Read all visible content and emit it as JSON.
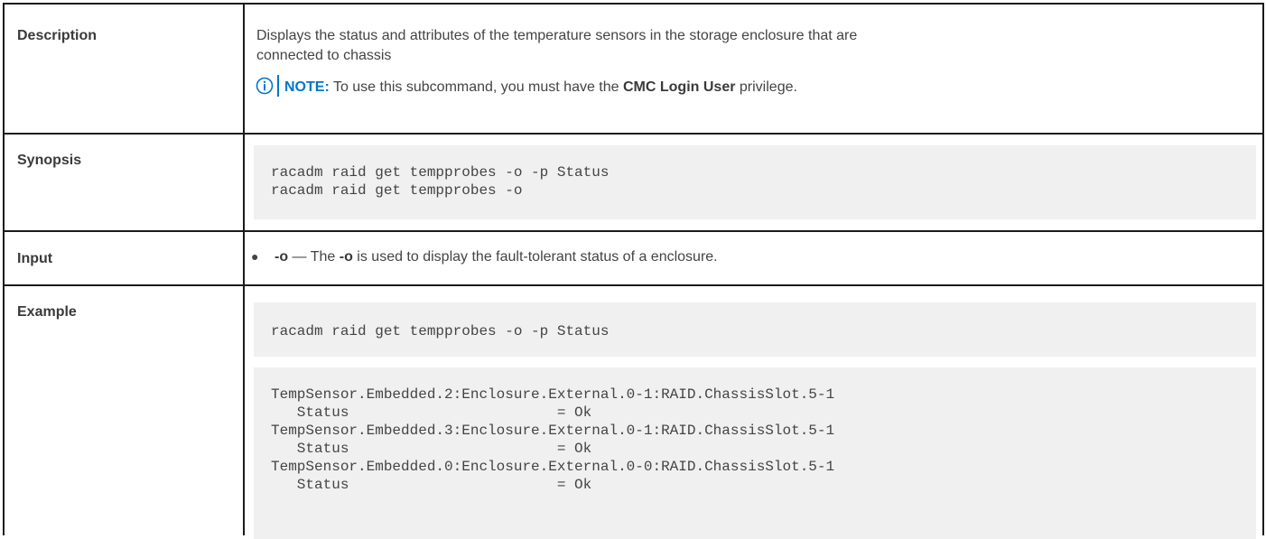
{
  "rows": {
    "description": {
      "label": "Description",
      "text_line1": "Displays the status and attributes of the temperature sensors in the storage enclosure that are",
      "text_line2": "connected to chassis",
      "note": {
        "icon": "info-circle-icon",
        "label": "NOTE:",
        "text_before": " To use this subcommand, you must have the ",
        "bold": "CMC Login User",
        "text_after": " privilege."
      }
    },
    "synopsis": {
      "label": "Synopsis",
      "code": "racadm raid get tempprobes -o -p Status\nracadm raid get tempprobes -o"
    },
    "input": {
      "label": "Input",
      "bullet": "●",
      "flag": "-o",
      "dash": " — The ",
      "flag2": "-o",
      "text": " is used to display the fault-tolerant status of a enclosure."
    },
    "example": {
      "label": "Example",
      "command": "racadm raid get tempprobes -o -p Status",
      "output": "TempSensor.Embedded.2:Enclosure.External.0-1:RAID.ChassisSlot.5-1\n   Status                        = Ok\nTempSensor.Embedded.3:Enclosure.External.0-1:RAID.ChassisSlot.5-1\n   Status                        = Ok\nTempSensor.Embedded.0:Enclosure.External.0-0:RAID.ChassisSlot.5-1\n   Status                        = Ok"
    }
  },
  "colors": {
    "border": "#1a1a1a",
    "code_bg": "#f0f0f0",
    "note_accent": "#0076ce"
  }
}
